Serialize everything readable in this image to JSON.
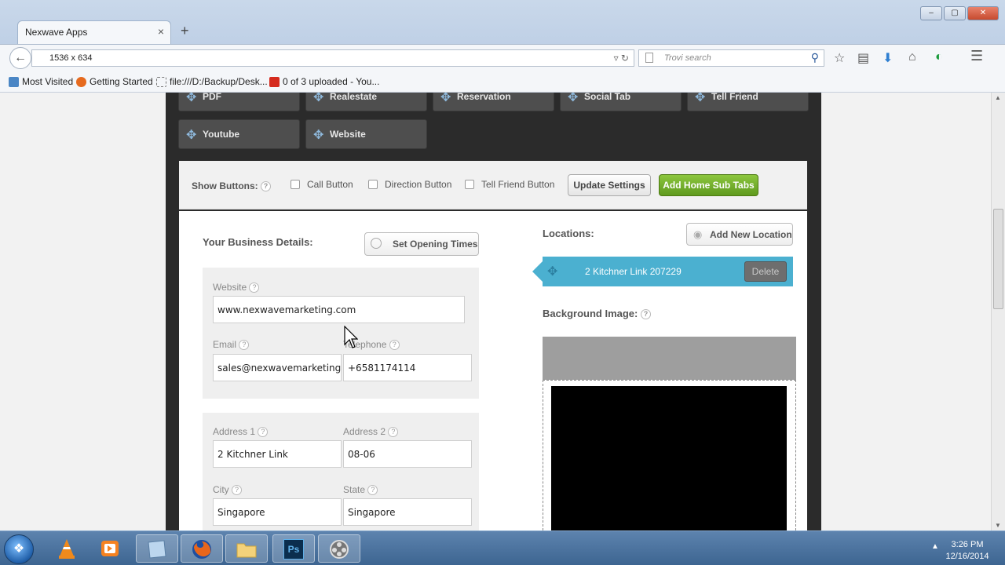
{
  "browser": {
    "tab_title": "Nexwave Apps",
    "tab_close": "×",
    "new_tab": "+",
    "url": "1536 x 634",
    "search_placeholder": "Trovi search",
    "window_buttons": [
      "–",
      "▢",
      "✕"
    ]
  },
  "bookmarks": [
    {
      "label": "Most Visited",
      "icon": "most-visited-icon"
    },
    {
      "label": "Getting Started",
      "icon": "firefox-icon"
    },
    {
      "label": "file:///D:/Backup/Desk...",
      "icon": "file-icon"
    },
    {
      "label": "0 of 3 uploaded - You...",
      "icon": "youtube-icon"
    }
  ],
  "tool_buttons": [
    "PDF",
    "Realestate",
    "Reservation",
    "Social Tab",
    "Tell Friend",
    "Youtube",
    "Website"
  ],
  "settings_bar": {
    "label": "Show Buttons:",
    "checkboxes": [
      "Call Button",
      "Direction Button",
      "Tell Friend Button"
    ],
    "update_label": "Update Settings",
    "add_label": "Add Home Sub Tabs"
  },
  "business": {
    "heading": "Your Business Details:",
    "opening_times": "Set Opening Times",
    "website_label": "Website",
    "website_value": "www.nexwavemarketing.com",
    "email_label": "Email",
    "email_value": "sales@nexwavemarketing",
    "telephone_label": "Telephone",
    "telephone_value": "+6581174114",
    "address1_label": "Address 1",
    "address1_value": "2 Kitchner Link",
    "address2_label": "Address 2",
    "address2_value": "08-06",
    "city_label": "City",
    "city_value": "Singapore",
    "state_label": "State",
    "state_value": "Singapore"
  },
  "locations": {
    "heading": "Locations:",
    "add_label": "Add New Location",
    "item_label": "2 Kitchner Link 207229",
    "delete_label": "Delete",
    "bg_heading": "Background Image:"
  },
  "help_mark": "?",
  "taskbar": {
    "apps": [
      "vlc-icon",
      "media-player-icon",
      "window-icon",
      "firefox-icon",
      "folder-icon",
      "photoshop-icon",
      "film-icon"
    ],
    "ps_label": "Ps",
    "time": "3:26 PM",
    "date": "12/16/2014"
  },
  "colors": {
    "accent_green": "#6ea72a",
    "location_blue": "#4bb0d0",
    "dark_panel": "#2b2b2b"
  }
}
